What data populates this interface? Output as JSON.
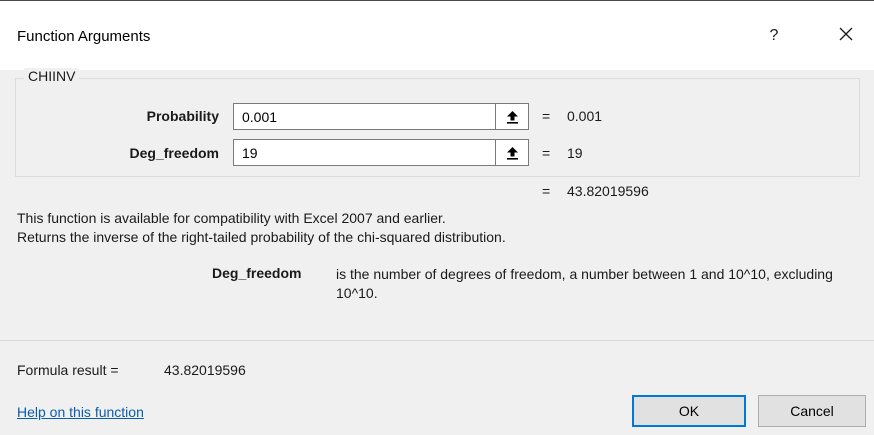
{
  "dialog": {
    "title": "Function Arguments",
    "help_glyph": "?",
    "function_name": "CHIINV"
  },
  "arguments": [
    {
      "label": "Probability",
      "value": "0.001",
      "equals": "=",
      "evaluated": "0.001"
    },
    {
      "label": "Deg_freedom",
      "value": "19",
      "equals": "=",
      "evaluated": "19"
    }
  ],
  "overall": {
    "equals": "=",
    "value": "43.82019596"
  },
  "description": {
    "line1": "This function is available for compatibility with Excel 2007 and earlier.",
    "line2": "Returns the inverse of the right-tailed probability of the chi-squared distribution.",
    "arg_name": "Deg_freedom",
    "arg_text": "is the number of degrees of freedom, a number between 1 and 10^10, excluding 10^10."
  },
  "result": {
    "label": "Formula result =",
    "value": "43.82019596"
  },
  "footer": {
    "help_link": "Help on this function",
    "ok_label": "OK",
    "cancel_label": "Cancel"
  },
  "colors": {
    "accent": "#0078d7",
    "link": "#0b5cad",
    "background": "#f0f0f0"
  },
  "icons": [
    "help-icon",
    "close-icon",
    "collapse-arrow-icon"
  ]
}
